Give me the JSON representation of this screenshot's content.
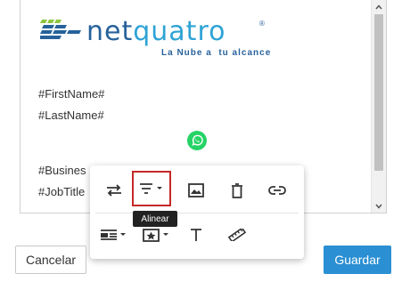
{
  "logo": {
    "brand_part1": "net",
    "brand_part2": "quatro",
    "registered": "®",
    "tagline": "La Nube a  tu alcance"
  },
  "editor": {
    "lines": [
      "#FirstName#",
      "#LastName#",
      "#Busines",
      "#JobTitle"
    ]
  },
  "toolbar": {
    "tooltip": "Alinear",
    "row1": [
      "swap-icon",
      "align-icon",
      "image-icon",
      "delete-icon",
      "link-icon"
    ],
    "row2": [
      "display-icon",
      "style-icon",
      "alt-text-icon",
      "size-icon"
    ]
  },
  "footer": {
    "cancel_label": "Cancelar",
    "save_label": "Guardar"
  },
  "colors": {
    "brand_dark": "#27629b",
    "brand_light": "#2ea3d5",
    "primary_button": "#2a8fd3",
    "active_outline": "#c62828",
    "whatsapp": "#25d366"
  }
}
